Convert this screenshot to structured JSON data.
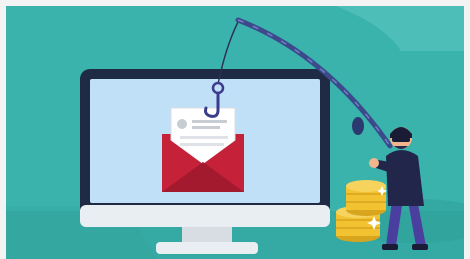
{
  "scene": {
    "subject": "phishing",
    "colors": {
      "background": "#3bb3ad",
      "background_dark": "#2f9f99",
      "monitor_bezel": "#1f2a44",
      "monitor_screen": "#bfe0f7",
      "monitor_base": "#e9eef2",
      "envelope": "#c5223a",
      "envelope_dark": "#a31a2f",
      "letter": "#ffffff",
      "hook": "#3b3d8c",
      "rod": "#3c4a8c",
      "coins": "#f2c230",
      "coins_shadow": "#d8a51f",
      "hacker_skin": "#f1b68d",
      "hacker_clothes": "#22264a"
    },
    "icons": [
      "fishing-rod-icon",
      "fish-hook-icon",
      "envelope-icon",
      "letter-icon",
      "monitor-icon",
      "coins-icon",
      "hacker-icon"
    ]
  }
}
